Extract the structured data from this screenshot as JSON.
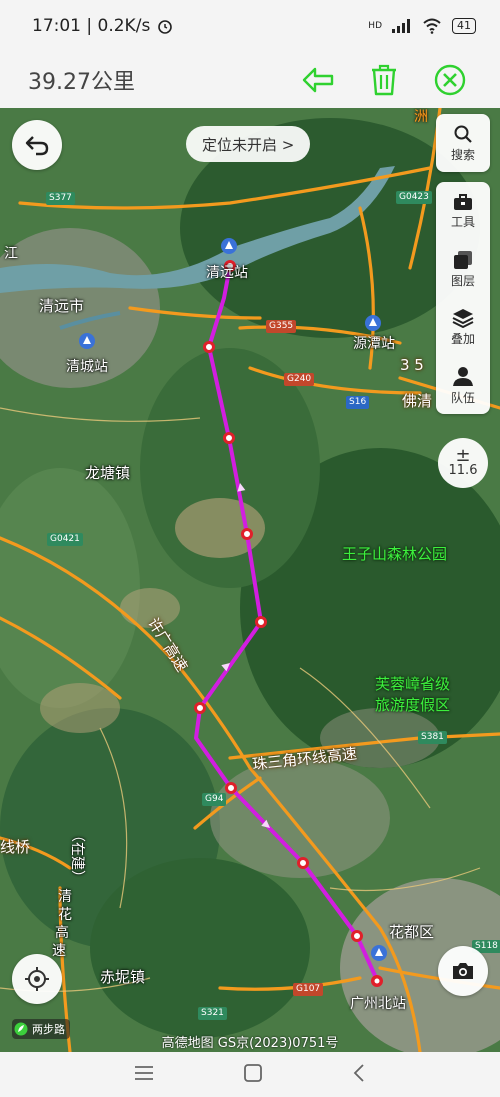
{
  "status_bar": {
    "time_speed": "17:01 | 0.2K/s",
    "hd_label": "HD",
    "battery": "41"
  },
  "header": {
    "distance": "39.27公里"
  },
  "map": {
    "locate_pill": "定位未开启 >",
    "side_tools": [
      {
        "icon": "search-icon",
        "label": "搜索"
      },
      {
        "icon": "toolbox-icon",
        "label": "工具"
      },
      {
        "icon": "layers-icon",
        "label": "图层"
      },
      {
        "icon": "stack-icon",
        "label": "叠加"
      },
      {
        "icon": "team-icon",
        "label": "队伍"
      }
    ],
    "zoom_sign": "±",
    "zoom_level": "11.6",
    "walk_badge": "两步路",
    "credit": "高德地图 GS京(2023)0751号",
    "track_color": "#d21ee0",
    "labels": {
      "qingyuan_station": "清远站",
      "qingyuan_city": "清远市",
      "qingcheng_station": "清城站",
      "yuantan_station": "源潭站",
      "longtang": "龙塘镇",
      "wangzishan": "王子山森林公园",
      "furong_1": "芙蓉嶂省级",
      "furong_2": "旅游度假区",
      "zhusanjiao": "珠三角环线高速",
      "xuguang": "许广高速",
      "huadu": "花都区",
      "guangzhou_north": "广州北站",
      "chini": "赤坭镇",
      "fo_qing": "佛清",
      "three_five": "3 5",
      "xianqiao": "线桥",
      "zaijian": "（在建）",
      "qinghua_1": "清",
      "qinghua_2": "花",
      "qinghua_3": "高",
      "qinghua_4": "速",
      "river_jiang": "江",
      "top_label": "洲"
    },
    "shields": {
      "s377": "S377",
      "g0423": "G0423",
      "g355": "G355",
      "g240": "G240",
      "s16": "S16",
      "g0421": "G0421",
      "s381": "S381",
      "g94": "G94",
      "g107": "G107",
      "s321": "S321",
      "s118": "S118"
    }
  }
}
